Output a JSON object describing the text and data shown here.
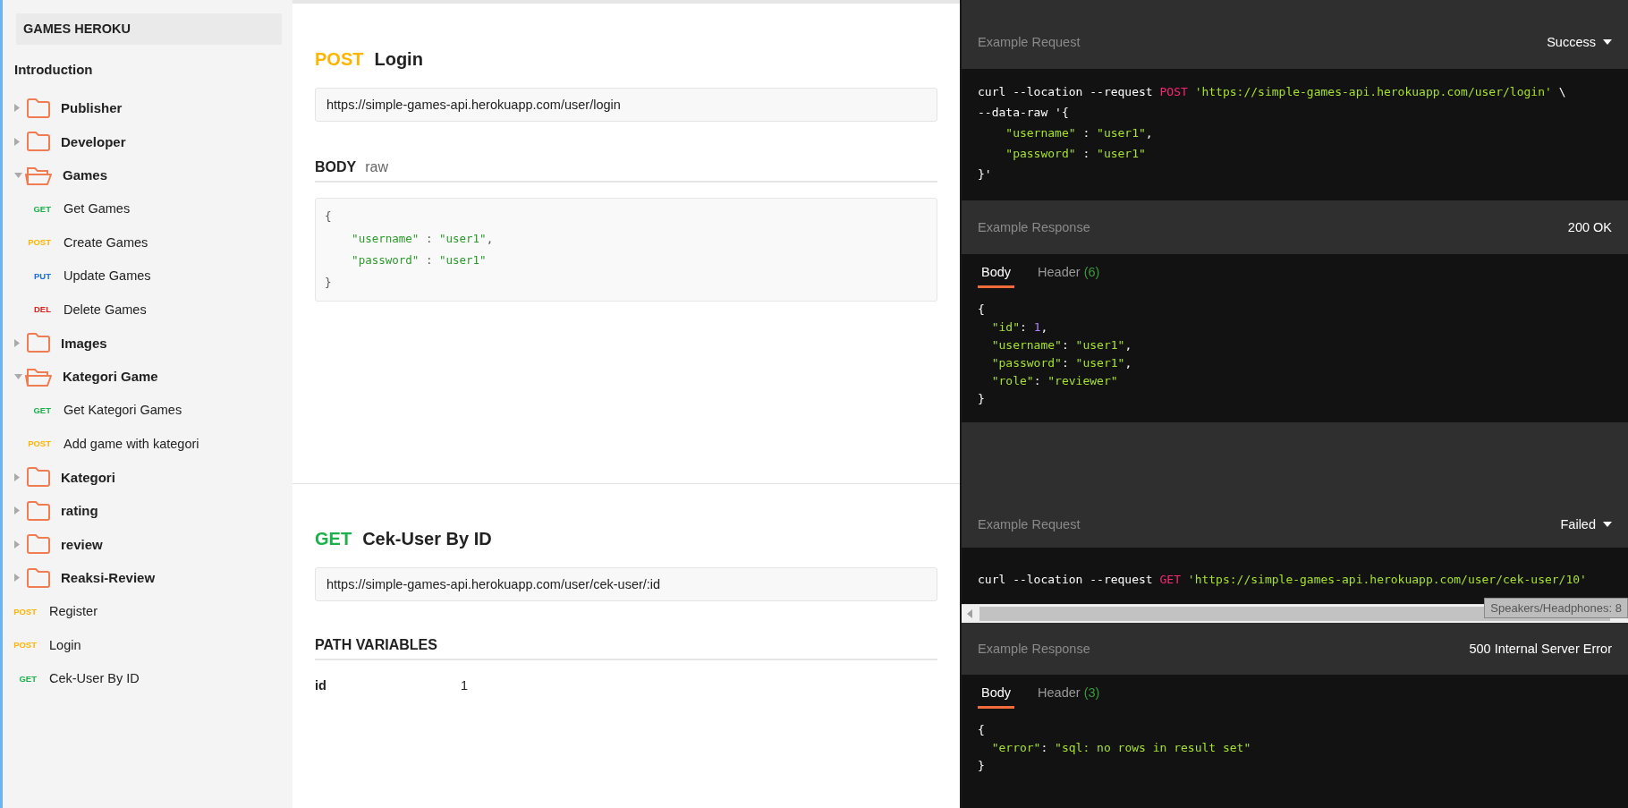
{
  "sidebar": {
    "title": "GAMES HEROKU",
    "introduction": "Introduction",
    "items": [
      {
        "kind": "folder",
        "label": "Publisher",
        "expanded": false
      },
      {
        "kind": "folder",
        "label": "Developer",
        "expanded": false
      },
      {
        "kind": "folder",
        "label": "Games",
        "expanded": true,
        "children": [
          {
            "kind": "request",
            "method": "GET",
            "color": "#1bb04a",
            "label": "Get Games"
          },
          {
            "kind": "request",
            "method": "POST",
            "color": "#ffb400",
            "label": "Create Games"
          },
          {
            "kind": "request",
            "method": "PUT",
            "color": "#1a6fe0",
            "label": "Update Games"
          },
          {
            "kind": "request",
            "method": "DEL",
            "color": "#e0201a",
            "label": "Delete Games"
          }
        ]
      },
      {
        "kind": "folder",
        "label": "Images",
        "expanded": false
      },
      {
        "kind": "folder",
        "label": "Kategori Game",
        "expanded": true,
        "children": [
          {
            "kind": "request",
            "method": "GET",
            "color": "#1bb04a",
            "label": "Get Kategori Games"
          },
          {
            "kind": "request",
            "method": "POST",
            "color": "#ffb400",
            "label": "Add game with kategori"
          }
        ]
      },
      {
        "kind": "folder",
        "label": "Kategori",
        "expanded": false
      },
      {
        "kind": "folder",
        "label": "rating",
        "expanded": false
      },
      {
        "kind": "folder",
        "label": "review",
        "expanded": false
      },
      {
        "kind": "folder",
        "label": "Reaksi-Review",
        "expanded": false
      },
      {
        "kind": "request",
        "method": "POST",
        "color": "#ffb400",
        "label": "Register"
      },
      {
        "kind": "request",
        "method": "POST",
        "color": "#ffb400",
        "label": "Login"
      },
      {
        "kind": "request",
        "method": "GET",
        "color": "#1bb04a",
        "label": "Cek-User By ID"
      }
    ]
  },
  "endpoints": [
    {
      "kind": "body",
      "method": "POST",
      "color": "#ffb400",
      "name": "Login",
      "url": "https://simple-games-api.herokuapp.com/user/login",
      "body": {
        "heading": "BODY",
        "mode": "raw",
        "lines": [
          [
            {
              "kind": "punct",
              "text": "{"
            }
          ],
          [
            {
              "kind": "string",
              "text": "    \"username\""
            },
            {
              "kind": "punct",
              "text": " : "
            },
            {
              "kind": "string",
              "text": "\"user1\""
            },
            {
              "kind": "punct",
              "text": ","
            }
          ],
          [
            {
              "kind": "string",
              "text": "    \"password\""
            },
            {
              "kind": "punct",
              "text": " : "
            },
            {
              "kind": "string",
              "text": "\"user1\""
            }
          ],
          [
            {
              "kind": "punct",
              "text": "}"
            }
          ]
        ]
      },
      "example": {
        "request_label": "Example Request",
        "status": "Success",
        "scrollbar": false,
        "request_lines": [
          [
            {
              "kind": "plain",
              "text": "curl --location --request "
            },
            {
              "kind": "keyword",
              "text": "POST"
            },
            {
              "kind": "string",
              "text": " 'https://simple-games-api.herokuapp.com/user/login'"
            },
            {
              "kind": "plain",
              "text": " \\"
            }
          ],
          [
            {
              "kind": "plain",
              "text": "--data-raw '{"
            }
          ],
          [
            {
              "kind": "string",
              "text": "    \"username\""
            },
            {
              "kind": "plain",
              "text": " : "
            },
            {
              "kind": "string",
              "text": "\"user1\""
            },
            {
              "kind": "plain",
              "text": ","
            }
          ],
          [
            {
              "kind": "string",
              "text": "    \"password\""
            },
            {
              "kind": "plain",
              "text": " : "
            },
            {
              "kind": "string",
              "text": "\"user1\""
            }
          ],
          [
            {
              "kind": "plain",
              "text": "}'"
            }
          ]
        ],
        "response_label": "Example Response",
        "response_status": "200 OK",
        "tabs": [
          {
            "label": "Body",
            "selected": true
          },
          {
            "label": "Header",
            "count": "(6)",
            "selected": false
          }
        ],
        "response_lines": [
          [
            {
              "kind": "plain",
              "text": "{"
            }
          ],
          [
            {
              "kind": "string",
              "text": "  \"id\""
            },
            {
              "kind": "plain",
              "text": ": "
            },
            {
              "kind": "number",
              "text": "1"
            },
            {
              "kind": "plain",
              "text": ","
            }
          ],
          [
            {
              "kind": "string",
              "text": "  \"username\""
            },
            {
              "kind": "plain",
              "text": ": "
            },
            {
              "kind": "string",
              "text": "\"user1\""
            },
            {
              "kind": "plain",
              "text": ","
            }
          ],
          [
            {
              "kind": "string",
              "text": "  \"password\""
            },
            {
              "kind": "plain",
              "text": ": "
            },
            {
              "kind": "string",
              "text": "\"user1\""
            },
            {
              "kind": "plain",
              "text": ","
            }
          ],
          [
            {
              "kind": "string",
              "text": "  \"role\""
            },
            {
              "kind": "plain",
              "text": ": "
            },
            {
              "kind": "string",
              "text": "\"reviewer\""
            }
          ],
          [
            {
              "kind": "plain",
              "text": "}"
            }
          ]
        ]
      }
    },
    {
      "kind": "path",
      "method": "GET",
      "color": "#1bb04a",
      "name": "Cek-User By ID",
      "url": "https://simple-games-api.herokuapp.com/user/cek-user/:id",
      "path_variables": {
        "heading": "PATH VARIABLES",
        "rows": [
          {
            "key": "id",
            "value": "1"
          }
        ]
      },
      "example": {
        "request_label": "Example Request",
        "status": "Failed",
        "scrollbar": true,
        "request_lines": [
          [
            {
              "kind": "plain",
              "text": "curl --location --request "
            },
            {
              "kind": "keyword",
              "text": "GET"
            },
            {
              "kind": "string",
              "text": " 'https://simple-games-api.herokuapp.com/user/cek-user/10'"
            }
          ]
        ],
        "tooltip": "Speakers/Headphones: 8",
        "response_label": "Example Response",
        "response_status": "500 Internal Server Error",
        "tabs": [
          {
            "label": "Body",
            "selected": true
          },
          {
            "label": "Header",
            "count": "(3)",
            "selected": false
          }
        ],
        "response_lines": [
          [
            {
              "kind": "plain",
              "text": "{"
            }
          ],
          [
            {
              "kind": "string",
              "text": "  \"error\""
            },
            {
              "kind": "plain",
              "text": ": "
            },
            {
              "kind": "string",
              "text": "\"sql: no rows in result set\""
            }
          ],
          [
            {
              "kind": "plain",
              "text": "}"
            }
          ]
        ]
      }
    }
  ]
}
